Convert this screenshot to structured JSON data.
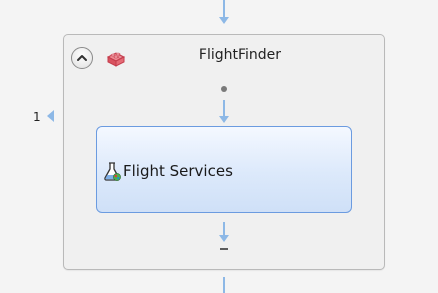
{
  "flow": {
    "group_title": "FlightFinder",
    "iteration_number": "1",
    "step_label": "Flight Services"
  },
  "icons": {
    "collapse": "chevron-up-icon",
    "group": "brick-icon",
    "step": "flask-icon"
  },
  "colors": {
    "connector": "#8db8e6",
    "step_border": "#6b9be0",
    "brick": "#e05a68"
  }
}
